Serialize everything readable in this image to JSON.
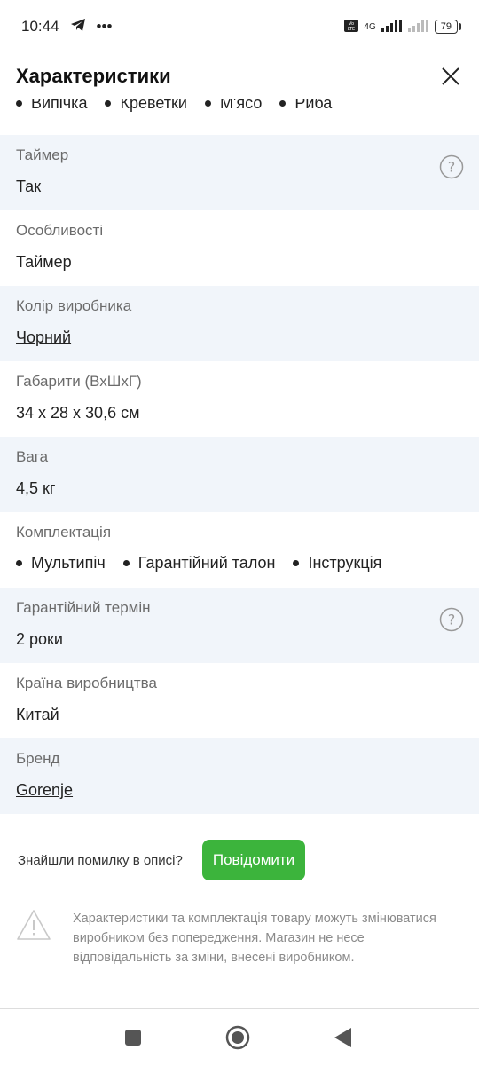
{
  "status_bar": {
    "time": "10:44",
    "more": "•••",
    "network": "4G",
    "battery": "79"
  },
  "header": {
    "title": "Характеристики"
  },
  "cut_items": [
    "Випічка",
    "Креветки",
    "М'ясо",
    "Риба"
  ],
  "specs": [
    {
      "label": "Таймер",
      "value": "Так",
      "help": true
    },
    {
      "label": "Особливості",
      "value": "Таймер"
    },
    {
      "label": "Колір виробника",
      "value": "Чорний",
      "link": true
    },
    {
      "label": "Габарити (ВхШхГ)",
      "value": "34 x 28 x 30,6 см"
    },
    {
      "label": "Вага",
      "value": "4,5 кг"
    },
    {
      "label": "Комплектація",
      "items": [
        "Мультипіч",
        "Гарантійний талон",
        "Інструкція"
      ]
    },
    {
      "label": "Гарантійний термін",
      "value": "2 роки",
      "help": true
    },
    {
      "label": "Країна виробництва",
      "value": "Китай"
    },
    {
      "label": "Бренд",
      "value": "Gorenje",
      "link": true
    }
  ],
  "report": {
    "text": "Знайшли помилку в описі?",
    "button": "Повідомити"
  },
  "disclaimer": {
    "text": "Характеристики та комплектація товару можуть змінюватися виробником без попередження. Магазин не несе відповідальність за зміни, внесені виробником."
  },
  "colors": {
    "accent": "#3cb43c",
    "row_alt": "#f1f5fa",
    "label": "#6b6b6b"
  }
}
